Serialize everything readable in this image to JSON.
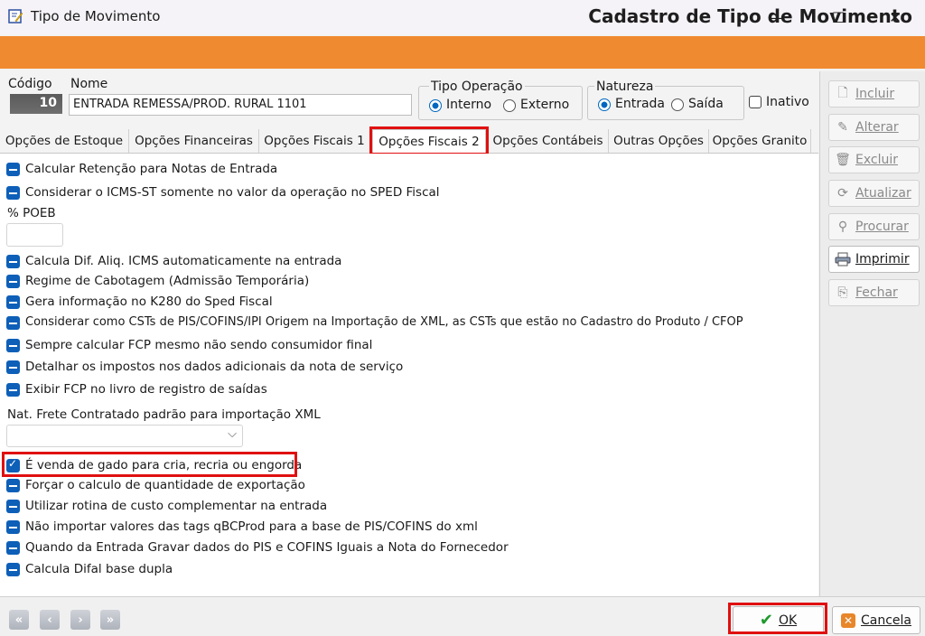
{
  "window": {
    "title": "Tipo de Movimento",
    "minimize": "—",
    "maximize": "☐",
    "close": "✕"
  },
  "banner": {
    "title": "Cadastro de Tipo de Movimento"
  },
  "header": {
    "codigo_label": "Código",
    "codigo_value": "10",
    "nome_label": "Nome",
    "nome_value": "ENTRADA REMESSA/PROD. RURAL 1101",
    "tipo_operacao": {
      "label": "Tipo Operação",
      "options": [
        "Interno",
        "Externo"
      ],
      "selected": "Interno"
    },
    "natureza": {
      "label": "Natureza",
      "options": [
        "Entrada",
        "Saída"
      ],
      "selected": "Entrada"
    },
    "inativo_label": "Inativo"
  },
  "tabs": [
    "Opções de Estoque",
    "Opções Financeiras",
    "Opções Fiscais 1",
    "Opções Fiscais 2",
    "Opções Contábeis",
    "Outras Opções",
    "Opções Granito"
  ],
  "active_tab": "Opções Fiscais 2",
  "options_a": [
    "Calcular Retenção para Notas de Entrada",
    "Considerar o ICMS-ST somente no valor da operação no SPED Fiscal"
  ],
  "poeb_label": "% POEB",
  "poeb_value": "",
  "options_b": [
    "Calcula Dif. Aliq. ICMS automaticamente na entrada",
    "Regime de Cabotagem (Admissão Temporária)",
    "Gera informação no K280 do Sped Fiscal",
    "Considerar como CSTs de PIS/COFINS/IPI Origem na Importação de XML, as CSTs que estão no Cadastro do Produto / CFOP",
    "Sempre calcular FCP mesmo não sendo consumidor final",
    "Detalhar os impostos nos dados adicionais da nota de serviço",
    "Exibir FCP no livro de registro de saídas"
  ],
  "frete_label": "Nat. Frete Contratado padrão para importação XML",
  "frete_value": "",
  "options_c": [
    "É venda de gado para cria, recria ou engorda",
    "Forçar o calculo de quantidade de exportação",
    "Utilizar rotina de custo complementar na entrada",
    "Não importar valores das tags qBCProd para a base de PIS/COFINS do xml",
    "Quando da Entrada Gravar dados do PIS e COFINS Iguais a Nota do Fornecedor",
    "Calcula Difal base dupla"
  ],
  "options_c_state": [
    "checked",
    "indeterminate",
    "indeterminate",
    "indeterminate",
    "indeterminate",
    "indeterminate"
  ],
  "sidebar": [
    {
      "label": "Incluir",
      "icon": "document-icon",
      "enabled": false
    },
    {
      "label": "Alterar",
      "icon": "pencil-icon",
      "enabled": false
    },
    {
      "label": "Excluir",
      "icon": "trash-icon",
      "enabled": false
    },
    {
      "label": "Atualizar",
      "icon": "refresh-icon",
      "enabled": false
    },
    {
      "label": "Procurar",
      "icon": "binoculars-icon",
      "enabled": false
    },
    {
      "label": "Imprimir",
      "icon": "printer-icon",
      "enabled": true
    },
    {
      "label": "Fechar",
      "icon": "close-door-icon",
      "enabled": false
    }
  ],
  "footer": {
    "nav": [
      "first-icon",
      "prev-icon",
      "next-icon",
      "last-icon"
    ],
    "ok_label": "OK",
    "cancel_label": "Cancela"
  },
  "colors": {
    "banner": "#f08a30",
    "highlight": "#e01010",
    "checkbox": "#0d5fb8",
    "ok_check": "#1d9a2c",
    "cancel_icon": "#e8862a"
  }
}
